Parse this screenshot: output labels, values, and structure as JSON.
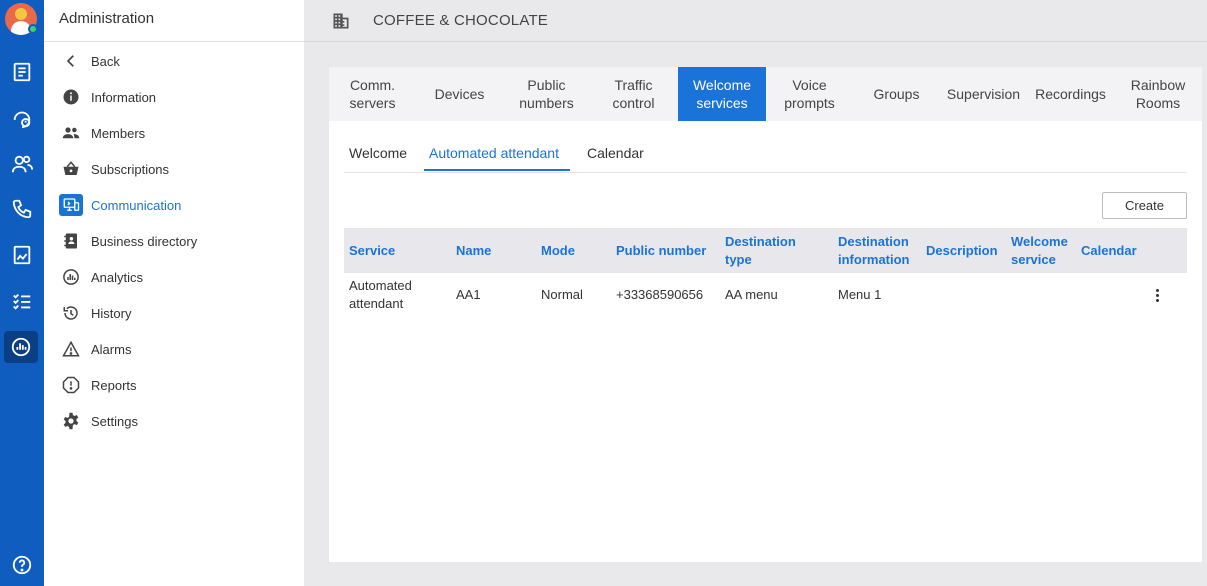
{
  "sidebar": {
    "title": "Administration",
    "items": [
      {
        "label": "Back",
        "icon": "chevron-left-icon"
      },
      {
        "label": "Information",
        "icon": "info-icon"
      },
      {
        "label": "Members",
        "icon": "members-icon"
      },
      {
        "label": "Subscriptions",
        "icon": "basket-icon"
      },
      {
        "label": "Communication",
        "icon": "communication-icon"
      },
      {
        "label": "Business directory",
        "icon": "directory-icon"
      },
      {
        "label": "Analytics",
        "icon": "analytics-icon"
      },
      {
        "label": "History",
        "icon": "history-icon"
      },
      {
        "label": "Alarms",
        "icon": "alarm-icon"
      },
      {
        "label": "Reports",
        "icon": "report-icon"
      },
      {
        "label": "Settings",
        "icon": "gear-icon"
      }
    ],
    "active_item": "Communication"
  },
  "header": {
    "company": "COFFEE & CHOCOLATE",
    "icon": "building-icon"
  },
  "tabs": [
    {
      "line1": "Comm.",
      "line2": "servers"
    },
    {
      "line1": "Devices",
      "line2": ""
    },
    {
      "line1": "Public",
      "line2": "numbers"
    },
    {
      "line1": "Traffic",
      "line2": "control"
    },
    {
      "line1": "Welcome",
      "line2": "services"
    },
    {
      "line1": "Voice",
      "line2": "prompts"
    },
    {
      "line1": "Groups",
      "line2": ""
    },
    {
      "line1": "Supervision",
      "line2": ""
    },
    {
      "line1": "Recordings",
      "line2": ""
    },
    {
      "line1": "Rainbow",
      "line2": "Rooms"
    }
  ],
  "active_tab": "Welcome services",
  "subtabs": [
    "Welcome",
    "Automated attendant",
    "Calendar"
  ],
  "active_subtab": "Automated attendant",
  "create_label": "Create",
  "table": {
    "headers": [
      {
        "line1": "Service",
        "line2": ""
      },
      {
        "line1": "Name",
        "line2": ""
      },
      {
        "line1": "Mode",
        "line2": ""
      },
      {
        "line1": "Public number",
        "line2": ""
      },
      {
        "line1": "Destination",
        "line2": "type"
      },
      {
        "line1": "Destination",
        "line2": "information"
      },
      {
        "line1": "Description",
        "line2": ""
      },
      {
        "line1": "Welcome",
        "line2": "service"
      },
      {
        "line1": "Calendar",
        "line2": ""
      }
    ],
    "rows": [
      {
        "service_line1": "Automated",
        "service_line2": "attendant",
        "name": "AA1",
        "mode": "Normal",
        "public_number": "+33368590656",
        "destination_type": "AA menu",
        "destination_information": "Menu 1",
        "description": "",
        "welcome_service": "",
        "calendar": ""
      }
    ]
  },
  "colors": {
    "accent": "#1a73d9",
    "rail": "#0e5dbf",
    "background": "#e9e9ec"
  }
}
